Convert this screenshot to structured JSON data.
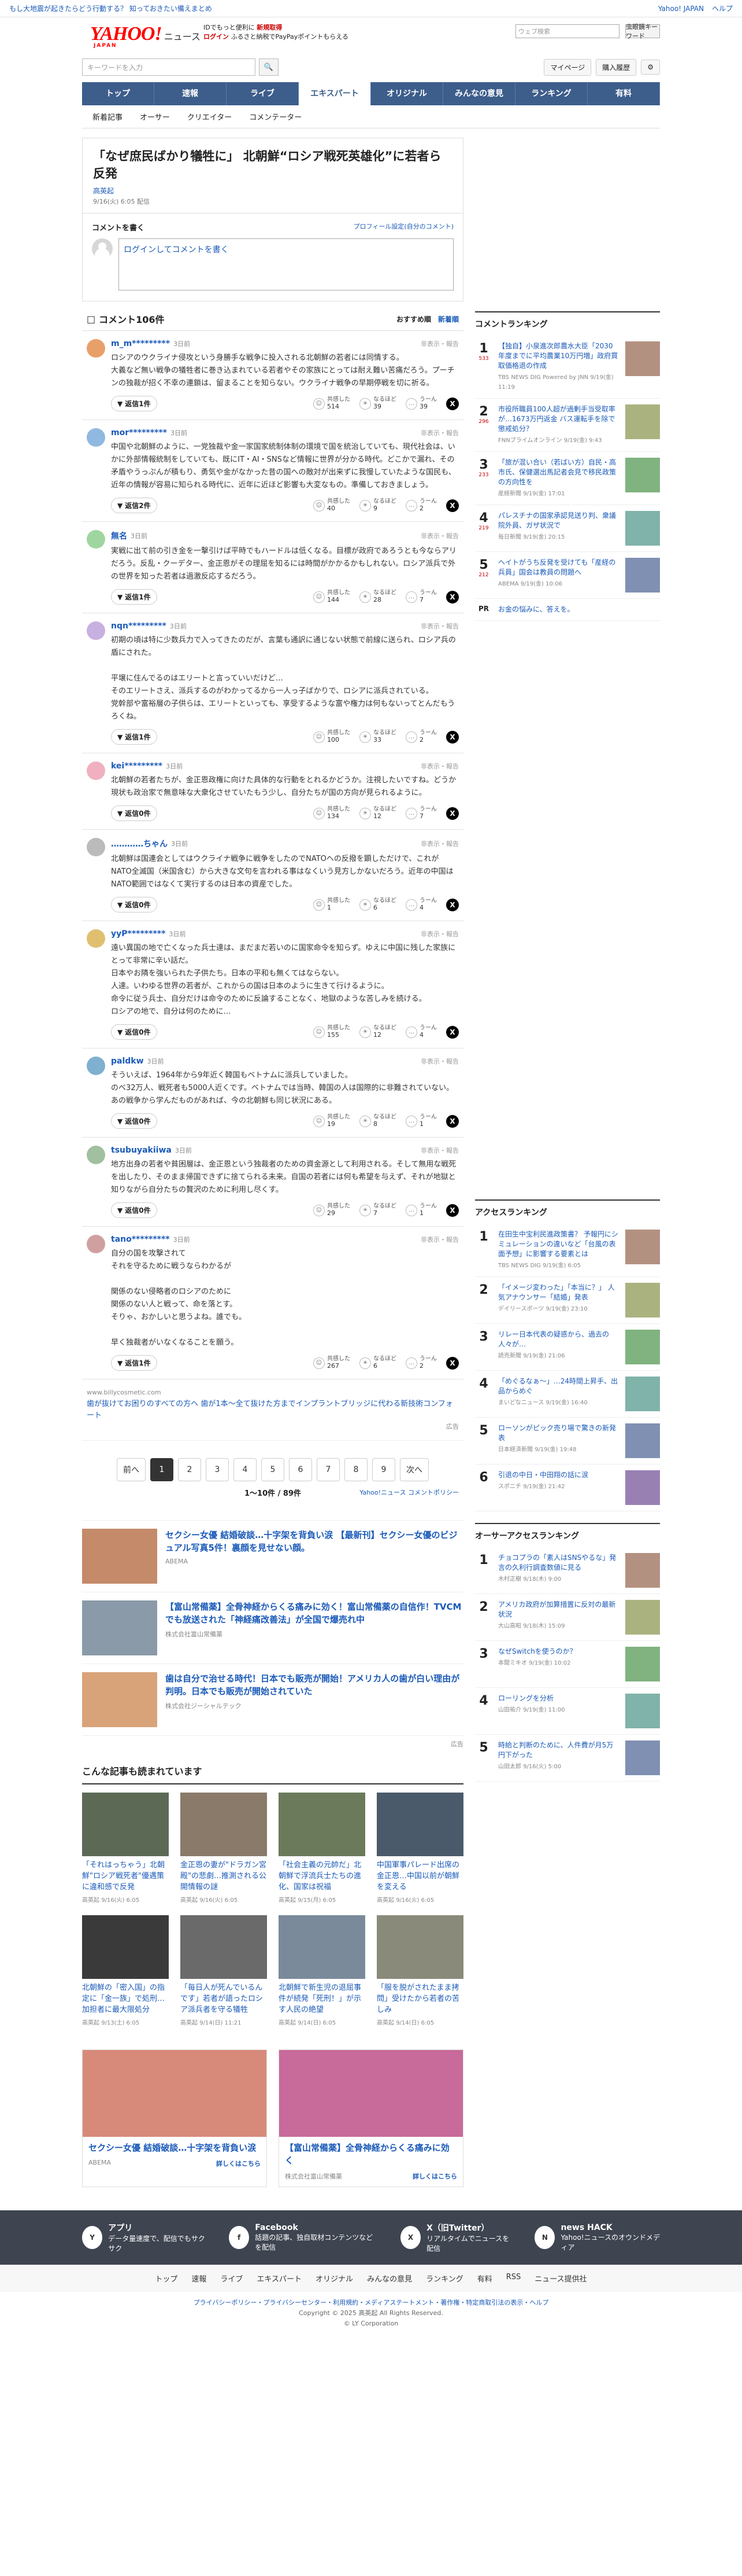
{
  "topbar": {
    "left": "もし大地震が起きたらどう行動する？ 知っておきたい備えまとめ",
    "links": [
      "Yahoo! JAPAN",
      "ヘルプ"
    ]
  },
  "header": {
    "logo": "YAHOO!",
    "logo_sub": "ニュース",
    "logo_jp": "JAPAN",
    "promo1": "IDでもっと便利に",
    "promo1_b": "新規取得",
    "promo2": "ログイン",
    "promo2_s": "ふるさと納税でPayPayポイントもらえる",
    "search_placeholder": "ウェブ検索",
    "search_btn": "虫眼鏡キーワード"
  },
  "ysearch": {
    "placeholder": "キーワードを入力",
    "mypage": "マイページ",
    "buy": "購入履歴"
  },
  "nav": [
    "トップ",
    "速報",
    "ライブ",
    "エキスパート",
    "オリジナル",
    "みんなの意見",
    "ランキング",
    "有料"
  ],
  "subnav": [
    "新着記事",
    "オーサー",
    "クリエイター",
    "コメンテーター"
  ],
  "article": {
    "title": "「なぜ庶民ばかり犠牲に」 北朝鮮“ロシア戦死英雄化”に若者ら反発",
    "source": "高英起",
    "date": "9/16(火) 6:05 配信"
  },
  "write": {
    "label": "コメントを書く",
    "profile": "プロフィール設定(自分のコメント)",
    "placeholder": "ログインしてコメントを書く"
  },
  "comments_head": {
    "title": "コメント106件",
    "sort1": "おすすめ順",
    "sort2": "新着順"
  },
  "labels": {
    "reply": "返信",
    "agree": "共感した",
    "think": "なるほど",
    "hmm": "うーん",
    "report": "非表示・報告"
  },
  "comments": [
    {
      "user": "m_m*********",
      "time": "3日前",
      "text": "ロシアのウクライナ侵攻という身勝手な戦争に投入される北朝鮮の若者には同情する。\n大義など無い戦争の犠牲者に巻き込まれている若者やその家族にとっては耐え難い苦痛だろう。プーチンの独裁が招く不幸の連鎖は、留まることを知らない。ウクライナ戦争の早期停戦を切に祈る。",
      "replies": "返信1件",
      "a": "514",
      "b": "39",
      "c": "39",
      "color": "#e8a06b"
    },
    {
      "user": "mor*********",
      "time": "3日前",
      "text": "中国や北朝鮮のように、一党独裁や金一家国家統制体制の環境で国を統治していても、現代社会は、いかに外部情報統制をしていても、既にIT・AI・SNSなど情報に世界が分かる時代。どこかで漏れ、その矛盾やうっぷんが積もり、勇気や金がなかった昔の国への敵対が出来ずに我慢していたような国民も、近年の情報が容易に知られる時代に、近年に近ほど影響も大変なもの。準備しておきましょう。",
      "replies": "返信2件",
      "a": "40",
      "b": "9",
      "c": "2",
      "color": "#8fb9e0"
    },
    {
      "user": "無名",
      "time": "3日前",
      "text": "実戦に出て前の引き金を一撃引けば平時でもハードルは低くなる。目標が政府であろうとも今ならアリだろう。反乱・クーデター、金正恩がその理屈を知るには時間がかかるかもしれない。ロシア派兵で外の世界を知った若者は過激反応するだろう。",
      "replies": "返信1件",
      "a": "144",
      "b": "28",
      "c": "7",
      "color": "#9fd69f"
    },
    {
      "user": "nqn*********",
      "time": "3日前",
      "text": "初期の頃は特に少数兵力で入ってきたのだが、言葉も通訳に通じない状態で前線に送られ、ロシア兵の盾にされた。\n\n平壌に住んでるのはエリートと言っていいだけど…\nそのエリートさえ、派兵するのがわかってるから一人っ子ばかりで、ロシアに派兵されている。\n党幹部や富裕層の子供らは、エリートといっても、享受するような富や権力は何もないってとんだもうろくね。",
      "replies": "返信1件",
      "a": "100",
      "b": "33",
      "c": "2",
      "color": "#c8b0e0"
    },
    {
      "user": "kei*********",
      "time": "3日前",
      "text": "北朝鮮の若者たちが、金正恩政権に向けた具体的な行動をとれるかどうか。注視したいですね。どうか現状も政治家で無意味な大衆化させていたもう少し、自分たちが国の方向が見られるように。",
      "replies": "返信0件",
      "a": "134",
      "b": "12",
      "c": "7",
      "color": "#f0b0c0"
    },
    {
      "user": "…………ちゃん",
      "time": "3日前",
      "text": "北朝鮮は国連会としてはウクライナ戦争に戦争をしたのでNATOへの反撥を顕しただけで、これがNATO全滅国（米国含む）から大きな文句を言われる事はなくいう見方しかないだろう。近年の中国はNATO範囲ではなくて実行するのは日本の資産でした。",
      "replies": "返信0件",
      "a": "1",
      "b": "6",
      "c": "4",
      "color": "#bbbbbb"
    },
    {
      "user": "yyP*********",
      "time": "3日前",
      "text": "遠い異国の地で亡くなった兵士達は、まだまだ若いのに国家命令を知らず。ゆえに中国に残した家族にとって非常に辛い話だ。\n日本やお隣を強いられた子供たち。日本の平和も無くてはならない。\n人達。いわゆる世界の若者が、これからの国は日本のように生きて行けるように。\n命令に従う兵士、自分だけは命令のために反論することなく、地獄のような苦しみを続ける。\nロシアの地で、自分は何のために…",
      "replies": "返信0件",
      "a": "155",
      "b": "12",
      "c": "4",
      "color": "#e0c070"
    },
    {
      "user": "paldkw",
      "time": "3日前",
      "text": "そういえば、1964年から9年近く韓国もベトナムに派兵していました。\nのべ32万人、戦死者も5000人近くです。ベトナムでは当時、韓国の人は国際的に非難されていない。あの戦争から学んだものがあれば、今の北朝鮮も同じ状況にある。",
      "replies": "返信0件",
      "a": "19",
      "b": "8",
      "c": "1",
      "color": "#7fb0d0"
    },
    {
      "user": "tsubuyakiiwa",
      "time": "3日前",
      "text": "地方出身の若者や貧困層は、金正恩という独裁者のための資金源として利用される。そして無用な戦死を出したり、そのまま帰国できずに捨てられる未来。自国の若者には何も希望を与えず、それが地獄と知りながら自分たちの贅沢のために利用し尽くす。",
      "replies": "返信0件",
      "a": "29",
      "b": "7",
      "c": "1",
      "color": "#a0c0a0"
    },
    {
      "user": "tano*********",
      "time": "3日前",
      "text": "自分の国を攻撃されて\nそれを守るために戦うならわかるが\n\n関係のない侵略者のロシアのために\n関係のない人と戦って、命を落とす。\nそりゃ、おかしいと思うよね。誰でも。\n\n早く独裁者がいなくなることを願う。",
      "replies": "返信1件",
      "a": "267",
      "b": "6",
      "c": "2",
      "color": "#d0a0a0"
    }
  ],
  "inline_ad": {
    "domain": "www.billycosmetic.com",
    "text": "歯が抜けてお困りのすべての方へ 歯が1本〜全て抜けた方までインプラントブリッジに代わる新技術コンフォート",
    "tag": "広告"
  },
  "pager": {
    "prev": "前へ",
    "pages": [
      "1",
      "2",
      "3",
      "4",
      "5",
      "6",
      "7",
      "8",
      "9"
    ],
    "next": "次へ",
    "count": "1〜10件 / 89件",
    "policy": "Yahoo!ニュース コメントポリシー"
  },
  "ads": [
    {
      "title": "セクシー女優 結婚破談…十字架を背負い涙 【最新刊】セクシー女優のビジュアル写真5件！裏顔を見せない顔。",
      "src": "ABEMA",
      "color": "#c48a6a"
    },
    {
      "title": "【富山常備薬】全骨神経からくる痛みに効く！富山常備薬の自信作！TVCMでも放送された「神経痛改善法」が全国で爆売れ中",
      "src": "株式会社富山常備薬",
      "color": "#8a9aa8"
    },
    {
      "title": "歯は自分で治せる時代！日本でも販売が開始！アメリカ人の歯が白い理由が判明。日本でも販売が開始されていた",
      "src": "株式会社ジーシャルテック",
      "color": "#d9a37a"
    }
  ],
  "ad_tag": "広告",
  "related": {
    "title": "こんな記事も読まれています",
    "items": [
      {
        "t": "「それはっちゃう」北朝鮮\"ロシア戦死者\"優遇策に違和感で反発",
        "s": "高英起",
        "d": "9/16(火) 6:05",
        "c": "#5c6a55"
      },
      {
        "t": "金正恩の妻が\"ドラガン宮殿\"の悲劇…推測される公開情報の謎",
        "s": "高英起",
        "d": "9/16(火) 6:05",
        "c": "#8a7a6a"
      },
      {
        "t": "「社会主義の元帥だ」北朝鮮で浮流兵士たちの進化、国家は祝福",
        "s": "高英起",
        "d": "9/15(月) 6:05",
        "c": "#6a7a5a"
      },
      {
        "t": "中国軍事パレード出席の金正恩…中国以前が朝鮮を変える",
        "s": "高英起",
        "d": "9/16(火) 6:05",
        "c": "#4a5a6a"
      },
      {
        "t": "北朝鮮の「密入国」の指定に「金一族」で処刑…加担者に最大限処分",
        "s": "高英起",
        "d": "9/13(土) 6:05",
        "c": "#3a3a3a"
      },
      {
        "t": "「毎日人が死んでいるんです」若者が語ったロシア派兵者を守る犠牲",
        "s": "高英起",
        "d": "9/14(日) 11:21",
        "c": "#6a6a6a"
      },
      {
        "t": "北朝鮮で新生児の退屈事件が続発「死刑！」が示す人民の絶望",
        "s": "高英起",
        "d": "9/14(日) 6:05",
        "c": "#7a8a9a"
      },
      {
        "t": "「服を脱がされたまま拷問」受けたから若者の苦しみ",
        "s": "高英起",
        "d": "9/14(日) 6:05",
        "c": "#8a8a7a"
      }
    ]
  },
  "bigads": [
    {
      "title": "セクシー女優 結婚破談…十字架を背負い涙",
      "src": "ABEMA",
      "more": "詳しくはこちら",
      "color": "#d88a7a"
    },
    {
      "title": "【富山常備薬】全骨神経からくる痛みに効く",
      "src": "株式会社富山常備薬",
      "more": "詳しくはこちら",
      "color": "#c86a9a"
    }
  ],
  "side": {
    "rank_title": "コメントランキング",
    "ranks": [
      {
        "n": "1",
        "c": "533",
        "t": "【独自】小泉進次郎農水大臣「2030年度までに平均農業10万円増」政府買取価格退の作成",
        "s": "TBS NEWS DIG Powered by JNN",
        "d": "9/19(金) 11:19"
      },
      {
        "n": "2",
        "c": "296",
        "t": "市役所職員100人超が過剰手当受取率が…1673万円返金 バス運転手を除で懲戒処分？",
        "s": "FNNプライムオンライン",
        "d": "9/19(金) 9:43"
      },
      {
        "n": "3",
        "c": "233",
        "t": "「旅が混い合い（若ばい方）自民・高市氏、保健選出馬記者会見で移民政策の方向性を",
        "s": "産経新聞",
        "d": "9/19(金) 17:01"
      },
      {
        "n": "4",
        "c": "219",
        "t": "パレスチナの国家承認見送り判、衆議院外員、ガザ状況で",
        "s": "毎日新聞",
        "d": "9/19(金) 20:15"
      },
      {
        "n": "5",
        "c": "212",
        "t": "ヘイトがうち反発を受けても「産経の兵員」国会は教員の問題へ",
        "s": "ABEMA",
        "d": "9/19(金) 10:06"
      }
    ],
    "pr": "PR",
    "pr_t": "お金の悩みに、答えを。",
    "access_title": "アクセスランキング",
    "access": [
      {
        "n": "1",
        "t": "在田生中宝利民進政策書？ 予報円にシミュレーションの違いなど「台風の表面予想」に影響する要素とは",
        "s": "TBS NEWS DIG",
        "d": "9/19(金) 6:05"
      },
      {
        "n": "2",
        "t": "「イメージ変わった」「本当に？」 人気アナウンサー「結婚」発表",
        "s": "デイリースポーツ",
        "d": "9/19(金) 23:10"
      },
      {
        "n": "3",
        "t": "リレー日本代表の疑惑から、過去の人々が…",
        "s": "読売新聞",
        "d": "9/19(金) 21:06"
      },
      {
        "n": "4",
        "t": "「めぐるなぁ〜」…24時間上昇手、出品からめぐ",
        "s": "まいどなニュース",
        "d": "9/19(金) 16:40"
      },
      {
        "n": "5",
        "t": "ローソンがピック売り場で驚きの新発表",
        "s": "日本経済新聞",
        "d": "9/19(金) 19:48"
      },
      {
        "n": "6",
        "t": "引退の中日・中田翔の話に涙",
        "s": "スポニチ",
        "d": "9/19(金) 21:42"
      }
    ],
    "expert_title": "オーサーアクセスランキング",
    "expert": [
      {
        "n": "1",
        "t": "チョコプラの「素人はSNSやるな」発言の久利行調査数値に見る",
        "s": "木村正樹",
        "d": "9/18(木) 9:00"
      },
      {
        "n": "2",
        "t": "アメリカ政府が加算措置に反対の最新状況",
        "s": "大山高昭",
        "d": "9/18(木) 15:09"
      },
      {
        "n": "3",
        "t": "なぜSwitchを使うのか？",
        "s": "本間ミキオ",
        "d": "9/19(金) 10:02"
      },
      {
        "n": "4",
        "t": "ローリングを分析",
        "s": "山田祐介",
        "d": "9/19(金) 11:00"
      },
      {
        "n": "5",
        "t": "時給と判断のために、人件費が月5万円下がった",
        "s": "山田太郎",
        "d": "9/16(火) 5:00"
      }
    ]
  },
  "footer": {
    "apps": [
      {
        "b": "アプリ",
        "s": "データ量速度で、配信でもサクサク",
        "i": "Y"
      },
      {
        "b": "Facebook",
        "s": "話題の記事、独自取材コンテンツなどを配信",
        "i": "f"
      },
      {
        "b": "X（旧Twitter）",
        "s": "リアルタイムでニュースを配信",
        "i": "X"
      },
      {
        "b": "news HACK",
        "s": "Yahoo!ニュースのオウンドメディア",
        "i": "N"
      }
    ],
    "nav": [
      "トップ",
      "速報",
      "ライブ",
      "エキスパート",
      "オリジナル",
      "みんなの意見",
      "ランキング",
      "有料",
      "RSS",
      "ニュース提供社"
    ],
    "links": "プライバシーポリシー・プライバシーセンター・利用規約・メディアステートメント・著作権・特定商取引法の表示・ヘルプ",
    "copy": "Copyright © 2025 高英起 All Rights Reserved.",
    "corp": "© LY Corporation"
  }
}
